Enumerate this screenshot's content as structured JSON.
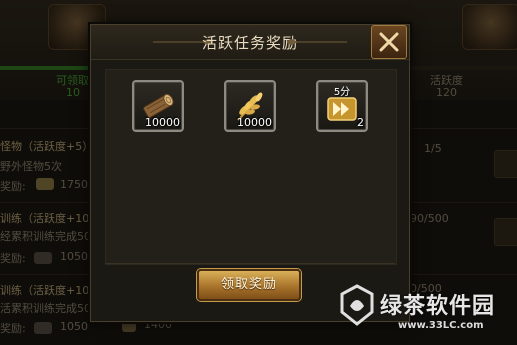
{
  "background": {
    "progress_left_label": "可领取",
    "progress_left_value": "10",
    "progress_right_label": "活跃度",
    "progress_right_value": "120",
    "tasks": [
      {
        "title": "怪物（活跃度+5）",
        "desc": "野外怪物5次",
        "reward_label": "奖励:",
        "reward_value": "1750",
        "progress": "1/5"
      },
      {
        "title": "训练（活跃度+10",
        "desc": "经累积训练完成50",
        "reward_label": "奖励:",
        "reward_value": "1050",
        "progress": "90/500"
      },
      {
        "title": "训练（活跃度+10",
        "desc": "活累积训练完成50",
        "reward_label": "奖励:",
        "reward_value": "1050",
        "extra_reward_value": "1400",
        "progress": "0/500"
      }
    ]
  },
  "dialog": {
    "title": "活跃任务奖励",
    "rewards": [
      {
        "icon": "wood-log-icon",
        "quantity": "10000"
      },
      {
        "icon": "wheat-icon",
        "quantity": "10000"
      },
      {
        "icon": "speedup-icon",
        "duration": "5分",
        "quantity": "2"
      }
    ],
    "claim_button": "领取奖励"
  },
  "watermark": {
    "brand": "绿茶软件园",
    "url": "www.33LC.com"
  },
  "colors": {
    "accent_gold": "#d9b058",
    "progress_green": "#3f8f2e",
    "dialog_bg": "#1b1914"
  }
}
